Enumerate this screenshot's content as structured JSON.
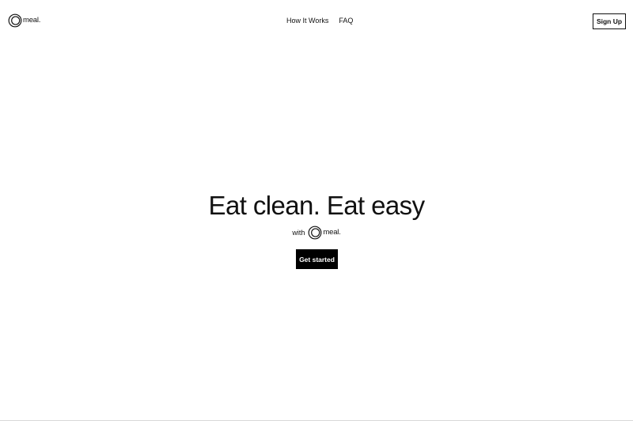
{
  "header": {
    "logo_text": "meal.",
    "nav": [
      {
        "label": "How It Works"
      },
      {
        "label": "FAQ"
      }
    ],
    "signup_label": "Sign Up"
  },
  "hero": {
    "title": "Eat clean. Eat easy",
    "with_text": "with",
    "logo_text": "meal.",
    "cta_label": "Get started"
  },
  "icons": {
    "logo": "concentric-circles-logo"
  },
  "colors": {
    "background": "#ffffff",
    "text": "#111111",
    "cta_background": "#000000",
    "cta_text": "#ffffff"
  }
}
